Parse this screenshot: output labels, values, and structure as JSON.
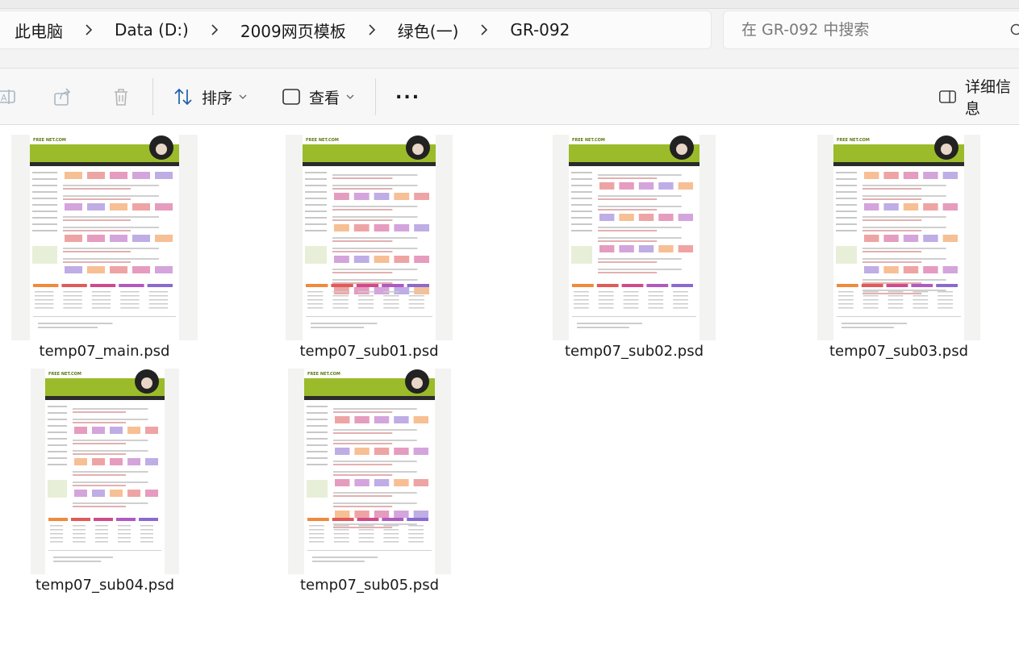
{
  "breadcrumb": {
    "items": [
      {
        "label": "此电脑"
      },
      {
        "label": "Data (D:)"
      },
      {
        "label": "2009网页模板"
      },
      {
        "label": "绿色(一)"
      },
      {
        "label": "GR-092"
      }
    ]
  },
  "search": {
    "placeholder": "在 GR-092 中搜索"
  },
  "toolbar": {
    "sort_label": "排序",
    "view_label": "查看",
    "more_label": "...",
    "details_label": "详细信息"
  },
  "thumbnail": {
    "logo_text": "FREE NET.COM"
  },
  "files": [
    {
      "name": "temp07_main.psd"
    },
    {
      "name": "temp07_sub01.psd"
    },
    {
      "name": "temp07_sub02.psd"
    },
    {
      "name": "temp07_sub03.psd"
    },
    {
      "name": "temp07_sub04.psd"
    },
    {
      "name": "temp07_sub05.psd"
    }
  ],
  "colors": {
    "accent_green": "#9bbb2a",
    "dark_nav": "#2b2b2b",
    "thumb_bg": "#f3f3f1"
  }
}
